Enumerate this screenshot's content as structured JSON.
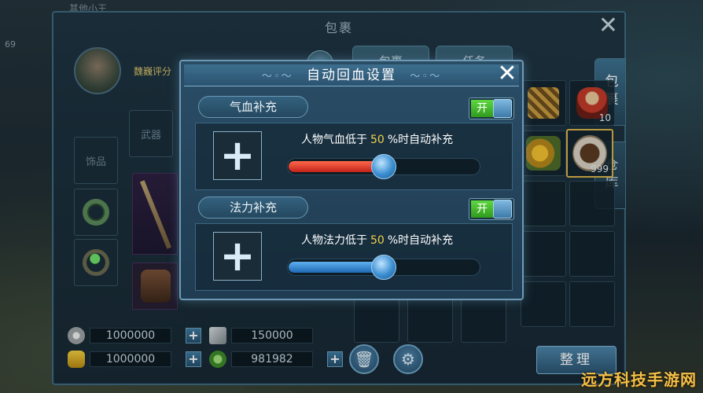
{
  "scene": {
    "background_name": "其他小王",
    "side_number": "69"
  },
  "bag_window": {
    "title": "包裹",
    "close_symbol": "✕",
    "character_name": "魏巍评分",
    "top_tabs": [
      "包裹",
      "任务"
    ],
    "side_tabs": [
      "包裹",
      "仓库"
    ],
    "equip_labels": [
      "武器",
      "饰品"
    ],
    "items": [
      {
        "icon": "fig-icon",
        "count": "10"
      },
      {
        "icon": "food-icon",
        "count": "999"
      }
    ],
    "currency": [
      {
        "icon": "silver-coin-icon",
        "value": "1000000"
      },
      {
        "icon": "gold-ingot-icon",
        "value": "1000000"
      }
    ],
    "currency_right": [
      {
        "icon": "fragment-icon",
        "value": "150000"
      },
      {
        "icon": "jade-icon",
        "value": "981982"
      }
    ],
    "plus_symbol": "+",
    "sort_button": "整理"
  },
  "modal": {
    "title": "自动回血设置",
    "flourish_left": "〜◦〜",
    "flourish_right": "〜◦〜",
    "close_symbol": "✕",
    "sections": [
      {
        "title": "气血补充",
        "toggle_label": "开",
        "enabled": true,
        "desc_prefix": "人物气血低于",
        "percent": "50",
        "desc_suffix": "%时自动补充",
        "value_fraction": 0.5,
        "bar_color": "#e0382a"
      },
      {
        "title": "法力补充",
        "toggle_label": "开",
        "enabled": true,
        "desc_prefix": "人物法力低于",
        "percent": "50",
        "desc_suffix": "%时自动补充",
        "value_fraction": 0.5,
        "bar_color": "#2f86d4"
      }
    ],
    "slot_symbol": "+"
  },
  "watermark": "远方科技手游网",
  "colors": {
    "accent_gold": "#f4d248",
    "toggle_green": "#3fb82a",
    "frame_blue": "#6e9ab6"
  }
}
